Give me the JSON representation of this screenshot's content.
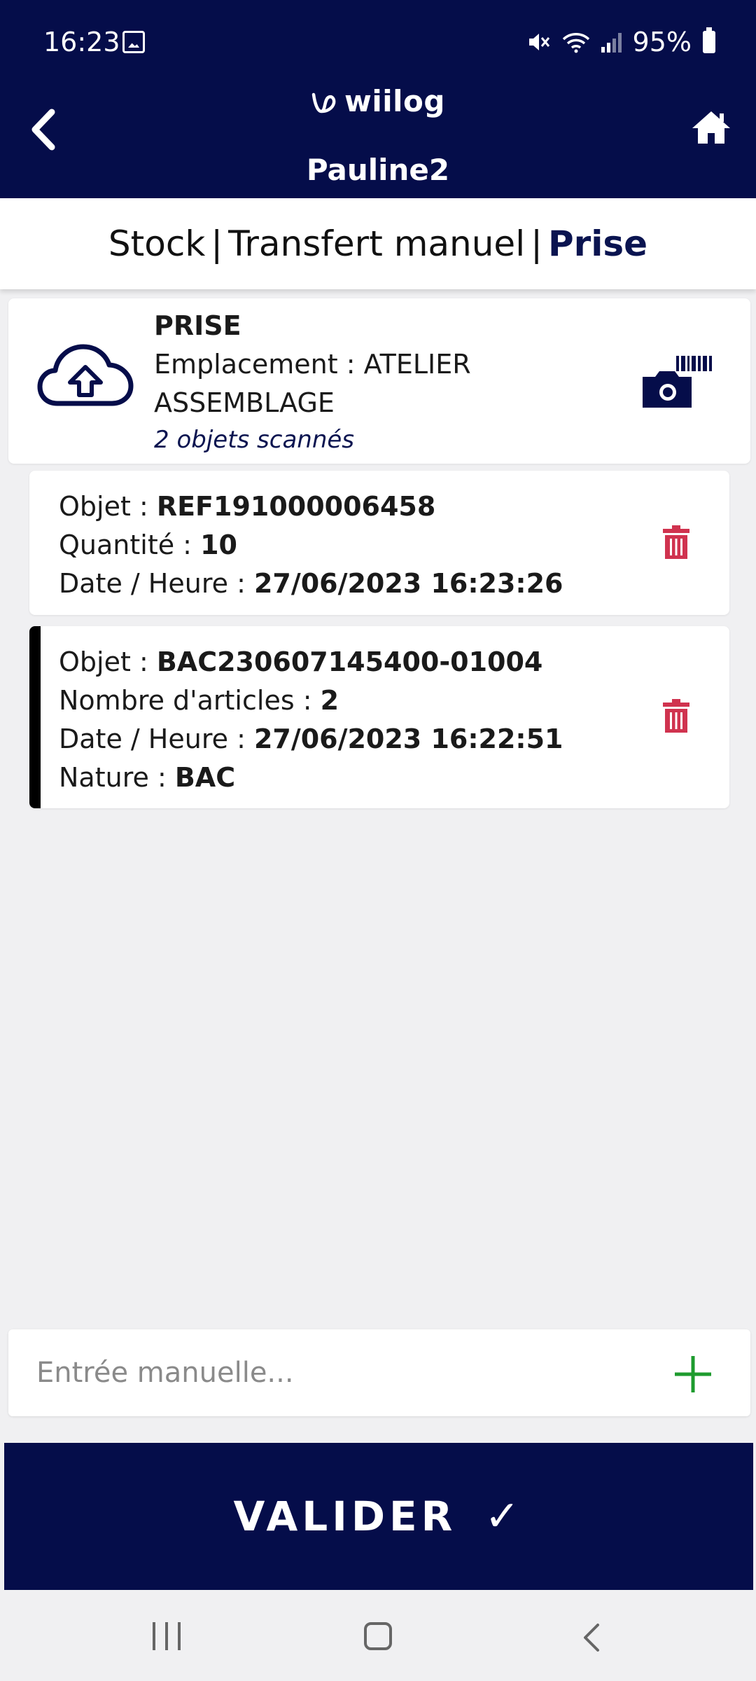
{
  "status_bar": {
    "time": "16:23",
    "battery": "95%"
  },
  "header": {
    "logo": "wiilog",
    "user": "Pauline2"
  },
  "breadcrumb": {
    "items": [
      "Stock",
      "Transfert manuel"
    ],
    "active": "Prise",
    "separator": "|"
  },
  "prise": {
    "title": "PRISE",
    "location_label": "Emplacement : ATELIER",
    "location_line2": "ASSEMBLAGE",
    "count": "2 objets scannés"
  },
  "objects": [
    {
      "objet_label": "Objet : ",
      "objet_value": "REF191000006458",
      "qty_label": "Quantité : ",
      "qty_value": "10",
      "date_label": "Date / Heure : ",
      "date_value": "27/06/2023 16:23:26"
    },
    {
      "objet_label": "Objet : ",
      "objet_value": "BAC230607145400-01004",
      "count_label": "Nombre d'articles : ",
      "count_value": "2",
      "date_label": "Date / Heure : ",
      "date_value": "27/06/2023 16:22:51",
      "nature_label": "Nature : ",
      "nature_value": "BAC"
    }
  ],
  "manual_entry": {
    "placeholder": "Entrée manuelle..."
  },
  "validate": {
    "label": "VALIDER",
    "check": "✓"
  },
  "colors": {
    "navy": "#050d4a",
    "delete": "#d0334f",
    "add": "#1e9b2e"
  }
}
